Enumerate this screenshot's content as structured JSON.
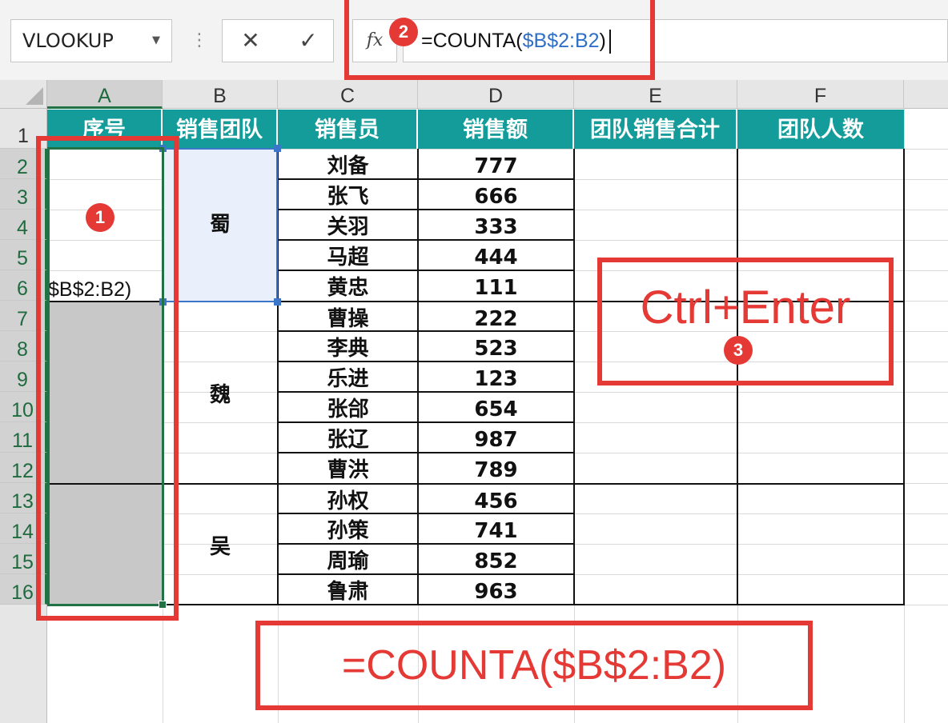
{
  "formula_bar": {
    "name_box": "VLOOKUP",
    "separator": "⋮",
    "cancel": "✕",
    "confirm": "✓",
    "fx": "fx",
    "formula_prefix": "=COUNTA(",
    "formula_ref": "$B$2:B2",
    "formula_suffix": ")"
  },
  "columns": [
    "A",
    "B",
    "C",
    "D",
    "E",
    "F"
  ],
  "rows": [
    "1",
    "2",
    "3",
    "4",
    "5",
    "6",
    "7",
    "8",
    "9",
    "10",
    "11",
    "12",
    "13",
    "14",
    "15",
    "16"
  ],
  "table": {
    "headers": [
      "序号",
      "销售团队",
      "销售员",
      "销售额",
      "团队销售合计",
      "团队人数"
    ],
    "teams": [
      "蜀",
      "魏",
      "吴"
    ],
    "rows": [
      {
        "name": "刘备",
        "amount": "777"
      },
      {
        "name": "张飞",
        "amount": "666"
      },
      {
        "name": "关羽",
        "amount": "333"
      },
      {
        "name": "马超",
        "amount": "444"
      },
      {
        "name": "黄忠",
        "amount": "111"
      },
      {
        "name": "曹操",
        "amount": "222"
      },
      {
        "name": "李典",
        "amount": "523"
      },
      {
        "name": "乐进",
        "amount": "123"
      },
      {
        "name": "张郃",
        "amount": "654"
      },
      {
        "name": "张辽",
        "amount": "987"
      },
      {
        "name": "曹洪",
        "amount": "789"
      },
      {
        "name": "孙权",
        "amount": "456"
      },
      {
        "name": "孙策",
        "amount": "741"
      },
      {
        "name": "周瑜",
        "amount": "852"
      },
      {
        "name": "鲁肃",
        "amount": "963"
      }
    ],
    "a_cell_edit_text": "$B$2:B2)"
  },
  "annotations": {
    "badge1": "1",
    "badge2": "2",
    "badge3": "3",
    "shortcut": "Ctrl+Enter",
    "formula_callout": "=COUNTA($B$2:B2)"
  },
  "colors": {
    "header_teal": "#139c9a",
    "excel_green": "#217346",
    "selection_blue": "#3b76c8",
    "callout_red": "#e53935"
  }
}
